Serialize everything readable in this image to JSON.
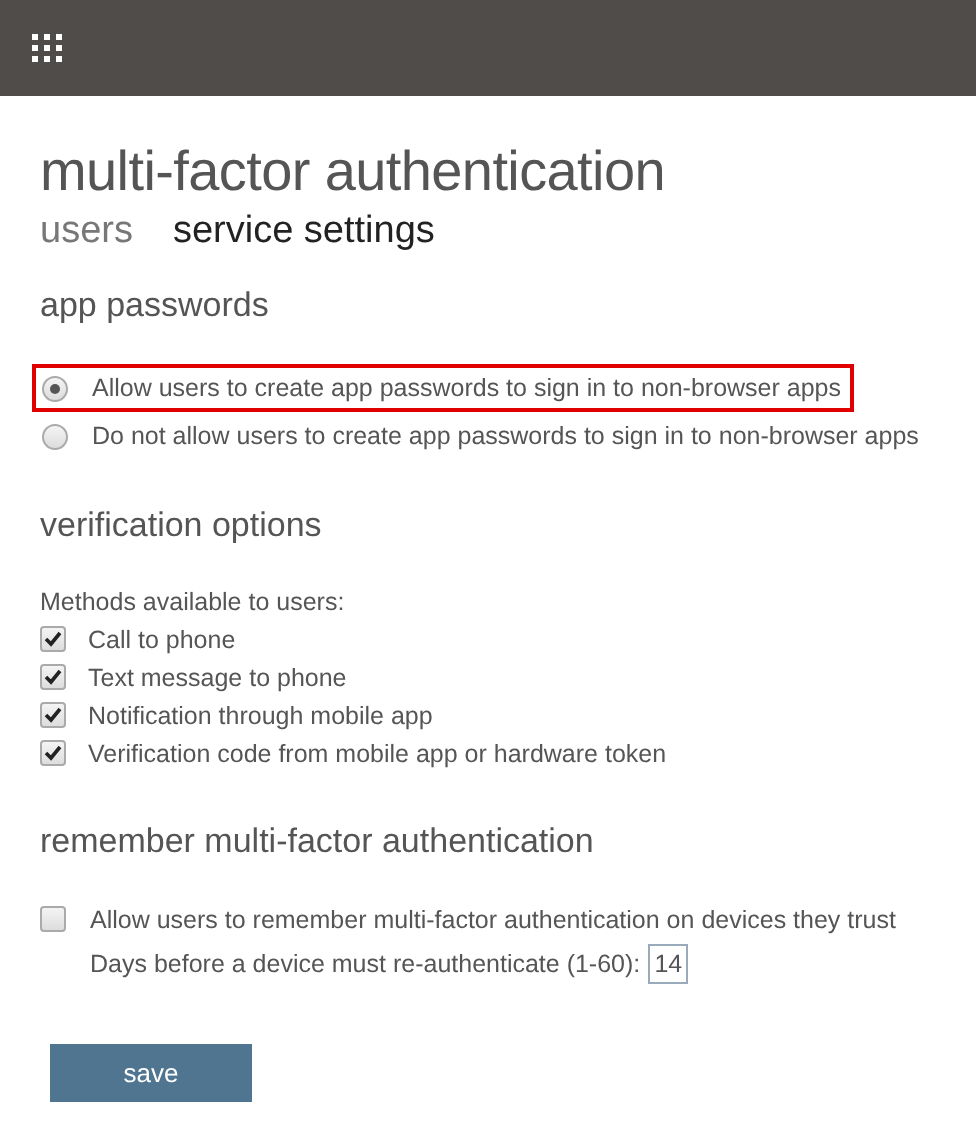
{
  "page_title": "multi-factor authentication",
  "tabs": [
    {
      "label": "users",
      "selected": false
    },
    {
      "label": "service settings",
      "selected": true
    }
  ],
  "app_passwords": {
    "heading": "app passwords",
    "options": [
      {
        "label": "Allow users to create app passwords to sign in to non-browser apps",
        "selected": true,
        "highlighted": true
      },
      {
        "label": "Do not allow users to create app passwords to sign in to non-browser apps",
        "selected": false,
        "highlighted": false
      }
    ]
  },
  "verification_options": {
    "heading": "verification options",
    "intro": "Methods available to users:",
    "methods": [
      {
        "label": "Call to phone",
        "checked": true
      },
      {
        "label": "Text message to phone",
        "checked": true
      },
      {
        "label": "Notification through mobile app",
        "checked": true
      },
      {
        "label": "Verification code from mobile app or hardware token",
        "checked": true
      }
    ]
  },
  "remember": {
    "heading": "remember multi-factor authentication",
    "option": {
      "label": "Allow users to remember multi-factor authentication on devices they trust",
      "checked": false
    },
    "days_label": "Days before a device must re-authenticate (1-60):",
    "days_value": "14"
  },
  "save_button": "save"
}
